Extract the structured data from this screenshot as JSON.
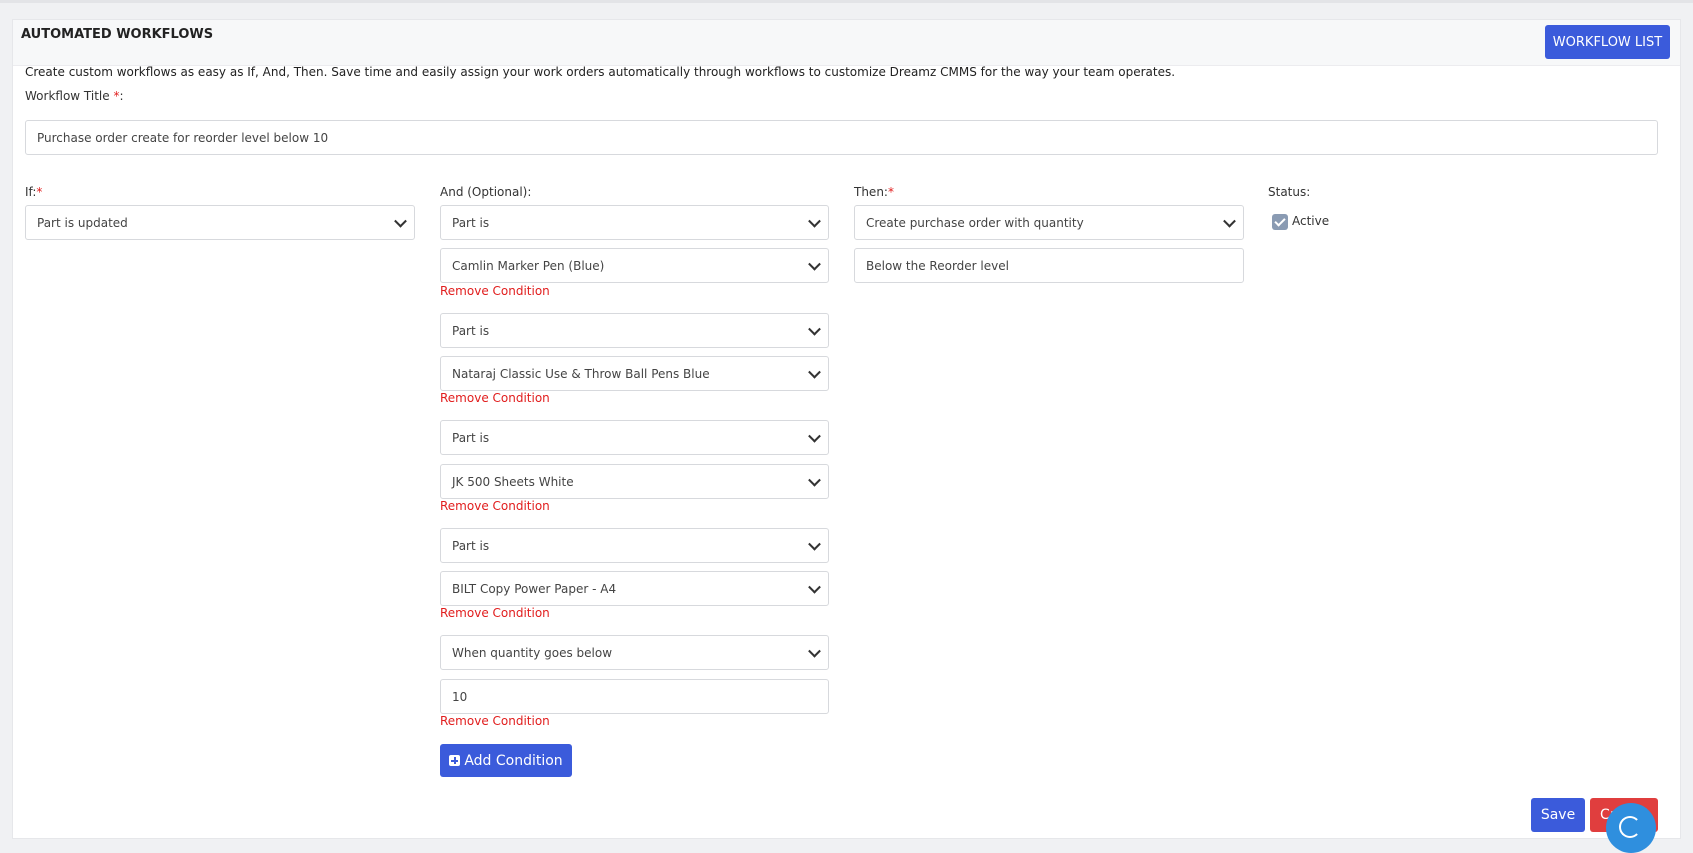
{
  "header": {
    "title": "AUTOMATED WORKFLOWS",
    "workflow_list_label": "WORKFLOW LIST"
  },
  "description": "Create custom workflows as easy as If, And, Then. Save time and easily assign your work orders automatically through workflows to customize Dreamz CMMS for the way your team operates.",
  "title_field": {
    "label": "Workflow Title",
    "required_mark": "*",
    "colon": ":",
    "value": "Purchase order create for reorder level below 10"
  },
  "if_section": {
    "label": "If:",
    "required_mark": "*",
    "selected": "Part is updated"
  },
  "and_section": {
    "label": "And (Optional):",
    "first_condition": "Part is",
    "conditions": [
      {
        "field": "Part is",
        "value": "Camlin Marker Pen (Blue)",
        "remove_label": "Remove Condition"
      },
      {
        "field": "Part is",
        "value": "Nataraj Classic Use & Throw Ball Pens Blue",
        "remove_label": "Remove Condition"
      },
      {
        "field": "Part is",
        "value": "JK 500 Sheets White",
        "remove_label": "Remove Condition"
      },
      {
        "field": "When quantity goes below",
        "value": "BILT Copy Power Paper - A4",
        "remove_label": "Remove Condition"
      },
      {
        "value": "10",
        "remove_label": "Remove Condition"
      }
    ],
    "add_label": "Add Condition"
  },
  "then_section": {
    "label": "Then:",
    "required_mark": "*",
    "selected": "Create purchase order with quantity",
    "value": "Below the Reorder level"
  },
  "status_section": {
    "label": "Status:",
    "active_label": "Active",
    "checked": true
  },
  "footer": {
    "save_label": "Save",
    "cancel_label": "Cancel"
  },
  "colors": {
    "primary": "#3b5bdb",
    "danger": "#e11d1d",
    "cancel": "#e03e3e",
    "chat": "#2f8fde"
  }
}
